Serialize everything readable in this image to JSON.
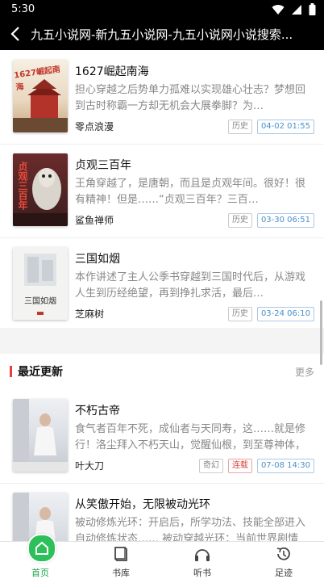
{
  "status": {
    "time": "5:30"
  },
  "appbar": {
    "title": "九五小说网-新九五小说网-九五小说网小说搜索..."
  },
  "history_books": [
    {
      "title": "1627崛起南海",
      "desc": "担心穿越之后势单力孤难以实现雄心壮志？梦想回到古时称霸一方却无机会大展拳脚？为…",
      "author": "零点浪漫",
      "tag": "历史",
      "time": "04-02 01:55",
      "cover_text": "1627崛起南海"
    },
    {
      "title": "贞观三百年",
      "desc": "王角穿越了，是唐朝，而且是贞观年间。很好！很有精神！但是……“贞观三百年？三百…",
      "author": "鲨鱼禅师",
      "tag": "历史",
      "time": "03-30 06:51",
      "cover_text": "贞观三百年"
    },
    {
      "title": "三国如烟",
      "desc": "本作讲述了主人公季书穿越到三国时代后，从游戏人生到历经绝望，再到挣扎求活，最后…",
      "author": "芝麻树",
      "tag": "历史",
      "time": "03-24 06:10",
      "cover_text": "三国如烟"
    }
  ],
  "section": {
    "label": "最近更新",
    "more": "更多"
  },
  "recent_books": [
    {
      "title": "不朽古帝",
      "desc": "食气者百年不死，成仙者与天同寿，这……就是修行！洛尘拜入不朽天山，觉醒仙根，到至尊神体，从此…",
      "author": "叶大刀",
      "tag": "奇幻",
      "status": "连载",
      "time": "07-08 14:30"
    },
    {
      "title": "从笑傲开始，无限被动光环",
      "desc": "被动修炼光环：开启后，所学功法、技能全部进入自动修炼状态…… 被动穿越光环：当前世界剧情参与到…",
      "author": "",
      "tag": "",
      "status": "",
      "time": ""
    }
  ],
  "nav": [
    {
      "label": "首页",
      "icon": "home-icon"
    },
    {
      "label": "书库",
      "icon": "book-icon"
    },
    {
      "label": "听书",
      "icon": "headphones-icon"
    },
    {
      "label": "足迹",
      "icon": "history-icon"
    }
  ],
  "colors": {
    "accent": "#2dbf59",
    "section_bar": "#e8413a",
    "time_tag": "#4a90c8"
  }
}
